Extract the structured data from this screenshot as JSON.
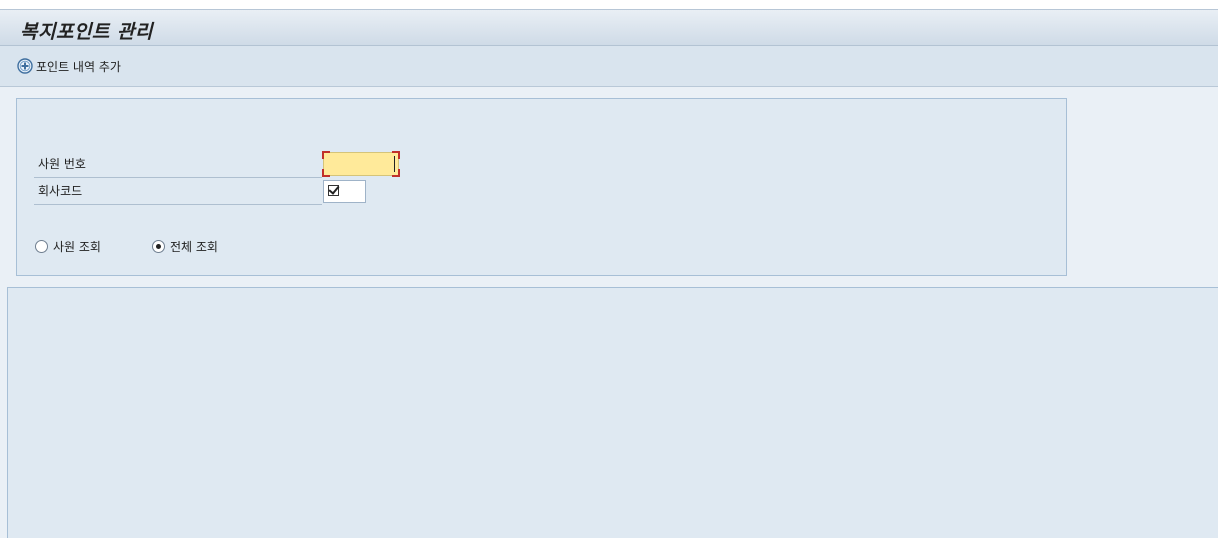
{
  "header": {
    "title": "복지포인트 관리"
  },
  "toolbar": {
    "add_button_label": "포인트 내역 추가",
    "add_icon": "add-circle-icon"
  },
  "selection": {
    "employee_number": {
      "label": "사원 번호",
      "value": ""
    },
    "company_code": {
      "label": "회사코드",
      "checked": true
    },
    "radios": [
      {
        "label": "사원 조회",
        "checked": false
      },
      {
        "label": "전체 조회",
        "checked": true
      }
    ]
  },
  "colors": {
    "title_bar": "#cfdbe7",
    "panel": "#dfe9f2",
    "input_required": "#ffea9a",
    "required_marker": "#c0302b"
  }
}
